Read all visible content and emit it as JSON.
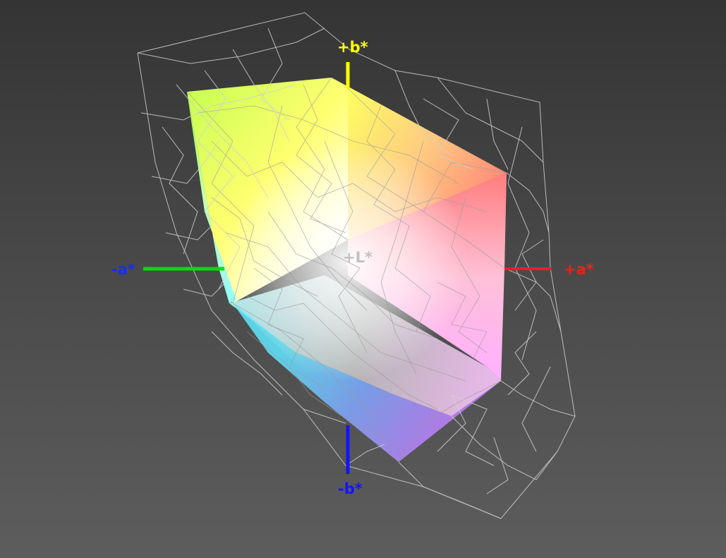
{
  "axes": {
    "plus_b": {
      "label": "+b*",
      "color": "#ffff00"
    },
    "minus_b": {
      "label": "-b*",
      "color": "#1414ff"
    },
    "plus_a": {
      "label": "+a*",
      "color": "#ff1a1a"
    },
    "minus_a": {
      "label": "-a*",
      "color": "#1a2bff",
      "line_color": "#00e000"
    },
    "plus_L": {
      "label": "+L*",
      "color": "#b8b8b8"
    }
  },
  "colors": {
    "background_top": "#343434",
    "background_bottom": "#5d5d5d",
    "wireframe": "#d0d0d0",
    "mesh": "#9a9a9a"
  }
}
